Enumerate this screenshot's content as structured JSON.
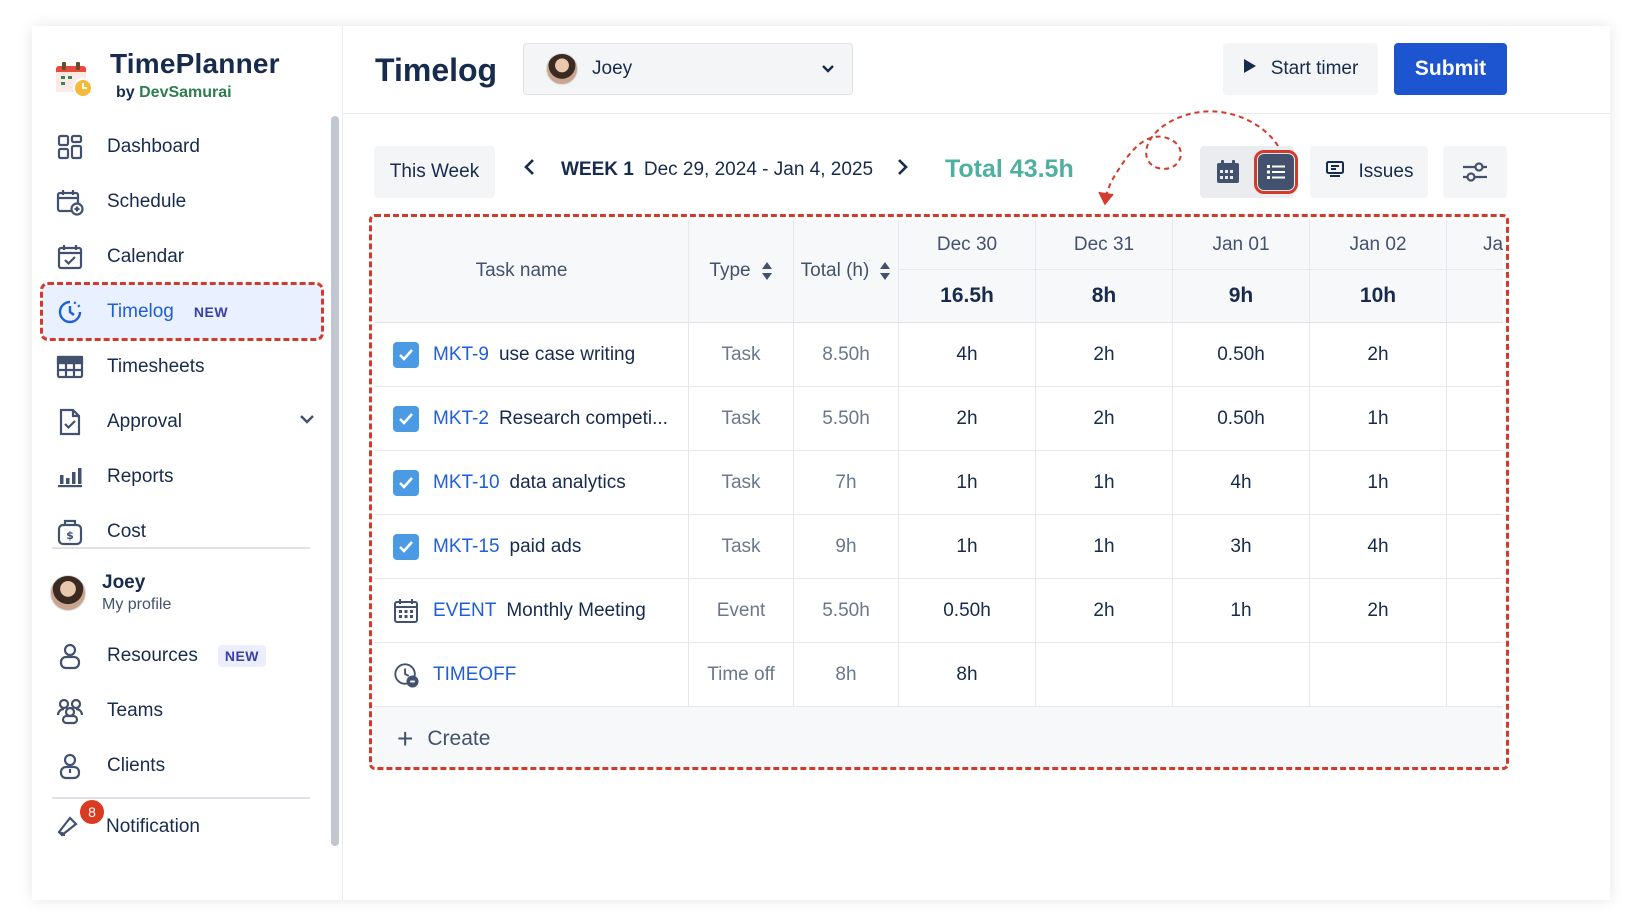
{
  "app": {
    "name": "TimePlanner",
    "by_prefix": "by",
    "by_name": "DevSamurai"
  },
  "sidebar": {
    "items": [
      {
        "label": "Dashboard",
        "icon": "dashboard-icon"
      },
      {
        "label": "Schedule",
        "icon": "schedule-icon"
      },
      {
        "label": "Calendar",
        "icon": "calendar-icon"
      },
      {
        "label": "Timelog",
        "icon": "clock-icon",
        "badge": "NEW",
        "active": true
      },
      {
        "label": "Timesheets",
        "icon": "table-icon"
      },
      {
        "label": "Approval",
        "icon": "approval-icon"
      },
      {
        "label": "Reports",
        "icon": "bar-chart-icon"
      },
      {
        "label": "Cost",
        "icon": "money-bag-icon"
      }
    ],
    "profile": {
      "name": "Joey",
      "sub": "My profile"
    },
    "items2": [
      {
        "label": "Resources",
        "icon": "resources-icon",
        "badge": "NEW"
      },
      {
        "label": "Teams",
        "icon": "teams-icon"
      },
      {
        "label": "Clients",
        "icon": "clients-icon"
      }
    ],
    "notification": {
      "label": "Notification",
      "count": "8"
    }
  },
  "header": {
    "title": "Timelog",
    "user": "Joey",
    "start_timer": "Start timer",
    "submit": "Submit"
  },
  "toolbar": {
    "this_week": "This Week",
    "week_label": "WEEK 1",
    "week_range": "Dec 29, 2024 - Jan 4, 2025",
    "total": "Total 43.5h",
    "issues": "Issues"
  },
  "table": {
    "columns": {
      "task": "Task name",
      "type": "Type",
      "total": "Total (h)"
    },
    "days": [
      {
        "name": "Dec 30",
        "total": "16.5h"
      },
      {
        "name": "Dec 31",
        "total": "8h"
      },
      {
        "name": "Jan 01",
        "total": "9h"
      },
      {
        "name": "Jan 02",
        "total": "10h"
      },
      {
        "name": "Ja",
        "total": ""
      }
    ],
    "rows": [
      {
        "key": "MKT-9",
        "name": "use case writing",
        "type": "Task",
        "total": "8.50h",
        "days": [
          "4h",
          "2h",
          "0.50h",
          "2h"
        ],
        "icon": "checkbox"
      },
      {
        "key": "MKT-2",
        "name": "Research competi...",
        "type": "Task",
        "total": "5.50h",
        "days": [
          "2h",
          "2h",
          "0.50h",
          "1h"
        ],
        "icon": "checkbox"
      },
      {
        "key": "MKT-10",
        "name": "data analytics",
        "type": "Task",
        "total": "7h",
        "days": [
          "1h",
          "1h",
          "4h",
          "1h"
        ],
        "icon": "checkbox"
      },
      {
        "key": "MKT-15",
        "name": "paid ads",
        "type": "Task",
        "total": "9h",
        "days": [
          "1h",
          "1h",
          "3h",
          "4h"
        ],
        "icon": "checkbox"
      },
      {
        "key": "EVENT",
        "name": "Monthly Meeting",
        "type": "Event",
        "total": "5.50h",
        "days": [
          "0.50h",
          "2h",
          "1h",
          "2h"
        ],
        "icon": "event"
      },
      {
        "key": "TIMEOFF",
        "name": "",
        "type": "Time off",
        "total": "8h",
        "days": [
          "8h",
          "",
          "",
          ""
        ],
        "icon": "timeoff"
      }
    ],
    "create": "Create"
  },
  "colors": {
    "accent": "#1d55d0",
    "link": "#1f5fd6",
    "total_green": "#4fb0a1",
    "annotation_red": "#d33a2c"
  }
}
